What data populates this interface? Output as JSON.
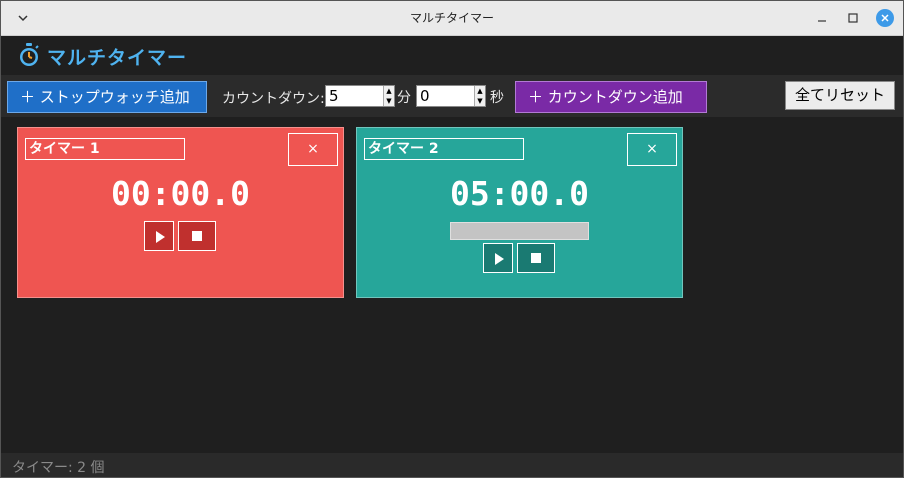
{
  "window": {
    "title": "マルチタイマー",
    "controls": [
      "chevron-down-icon",
      "minimize-icon",
      "maximize-icon",
      "close-icon"
    ]
  },
  "header": {
    "icon": "stopwatch-icon",
    "title": "マルチタイマー",
    "title_color": "#4fb3f0"
  },
  "toolbar": {
    "add_stopwatch_label": "＋ ストップウォッチ追加",
    "countdown_label": "カウントダウン:",
    "minutes_value": "5",
    "minutes_unit": "分",
    "seconds_value": "0",
    "seconds_unit": "秒",
    "add_countdown_label": "＋ カウントダウン追加",
    "reset_all_label": "全てリセット",
    "colors": {
      "stopwatch_button": "#1f6fc8",
      "countdown_button": "#7a2aa6"
    }
  },
  "timers": [
    {
      "name": "タイマー 1",
      "close_label": "×",
      "time": "00:00.0",
      "color": "#ef5551",
      "has_progress": false
    },
    {
      "name": "タイマー 2",
      "close_label": "×",
      "time": "05:00.0",
      "color": "#26a69a",
      "has_progress": true,
      "progress": 0
    }
  ],
  "status": {
    "text": "タイマー: 2 個"
  }
}
